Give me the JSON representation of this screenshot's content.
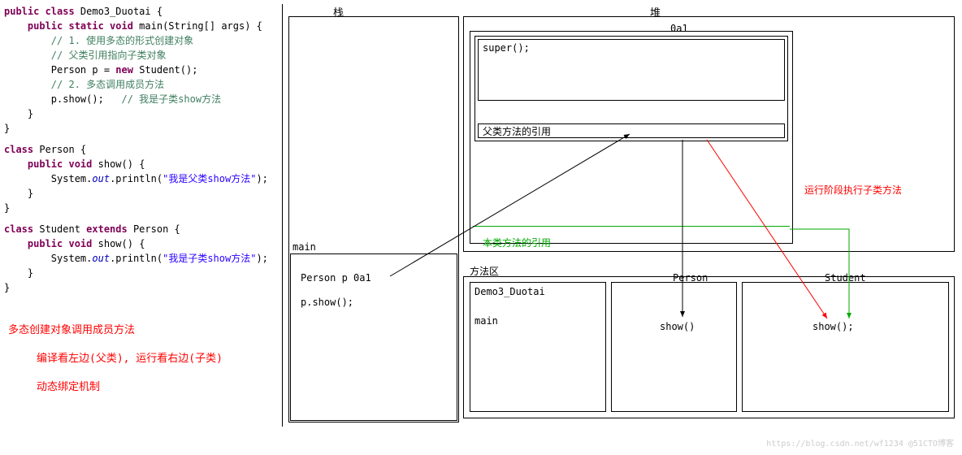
{
  "code": {
    "l1_kw1": "public class",
    "l1_name": " Demo3_Duotai {",
    "l2_kw": "public static void",
    "l2_name": " main(String[] args) {",
    "l3": "// 1. 使用多态的形式创建对象",
    "l4": "// 父类引用指向子类对象",
    "l5_a": "Person p = ",
    "l5_kw": "new",
    "l5_b": " Student();",
    "l6": "// 2. 多态调用成员方法",
    "l7_a": "p.show();   ",
    "l7_b": "// 我是子类show方法",
    "l8": "    }",
    "l9": "}",
    "l10_kw": "class",
    "l10_name": " Person {",
    "l11_kw": "public void",
    "l11_name": " show() {",
    "l12_a": "        System.",
    "l12_out": "out",
    "l12_b": ".println(",
    "l12_str": "\"我是父类show方法\"",
    "l12_c": ");",
    "l13": "    }",
    "l14": "}",
    "l15_kw": "class",
    "l15_a": " Student ",
    "l15_kw2": "extends",
    "l15_b": " Person {",
    "l16_kw": "public void",
    "l16_name": " show() {",
    "l17_a": "        System.",
    "l17_out": "out",
    "l17_b": ".println(",
    "l17_str": "\"我是子类show方法\"",
    "l17_c": ");",
    "l18": "    }",
    "l19": "}"
  },
  "notes": {
    "n1": "多态创建对象调用成员方法",
    "n2": "编译看左边(父类), 运行看右边(子类)",
    "n3": "动态绑定机制"
  },
  "labels": {
    "stack": "栈",
    "heap": "堆",
    "method_area": "方法区",
    "main": "main",
    "address": "0a1"
  },
  "stack": {
    "l1": "Person p    0a1",
    "l2": "p.show();"
  },
  "heap": {
    "super": "super();",
    "parent_ref": "父类方法的引用",
    "self_ref": "本类方法的引用",
    "runtime_note": "运行阶段执行子类方法"
  },
  "method_area": {
    "demo": "Demo3_Duotai",
    "main": "main",
    "person": "Person",
    "person_show": "show()",
    "student": "Student",
    "student_show": "show();"
  },
  "watermark": "https://blog.csdn.net/wf1234 @51CTO博客"
}
